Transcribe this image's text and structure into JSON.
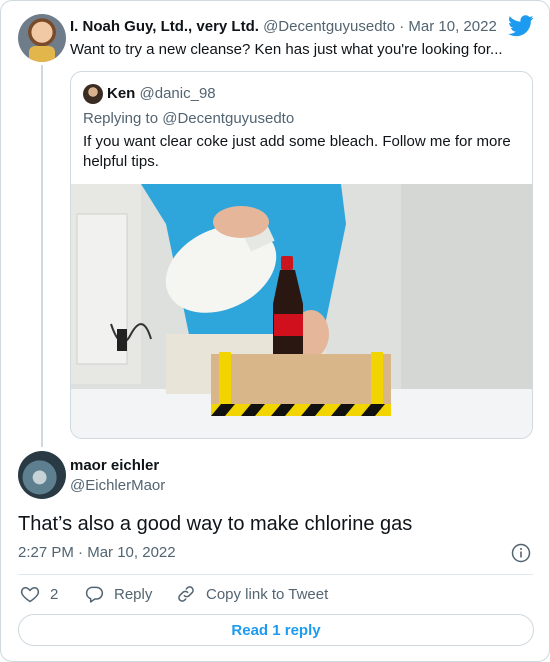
{
  "tweet": {
    "author_name": "I. Noah Guy, Ltd., very Ltd.",
    "author_handle": "@Decentguyusedto",
    "separator": "·",
    "date": "Mar 10, 2022",
    "text": "Want to try a new cleanse? Ken has just what you're looking for..."
  },
  "quoted": {
    "author_name": "Ken",
    "author_handle": "@danic_98",
    "replying_to_label": "Replying to",
    "replying_to_handle": "@Decentguyusedto",
    "text": "If you want clear coke just add some bleach. Follow me for more helpful tips.",
    "media": {
      "bottle_label": "Coca-Cola"
    }
  },
  "reply": {
    "author_name": "maor eichler",
    "author_handle": "@EichlerMaor",
    "text": "That’s also a good way to make chlorine gas",
    "time": "2:27 PM",
    "separator": "·",
    "date": "Mar 10, 2022"
  },
  "actions": {
    "like_count": "2",
    "reply_label": "Reply",
    "copy_label": "Copy link to Tweet",
    "read_replies_label": "Read 1 reply"
  },
  "colors": {
    "brand_blue": "#1d9bf0",
    "muted_text": "#536471",
    "border": "#cfd9de"
  },
  "icons": [
    "twitter-bird-icon",
    "info-icon",
    "heart-icon",
    "reply-icon",
    "link-icon"
  ]
}
